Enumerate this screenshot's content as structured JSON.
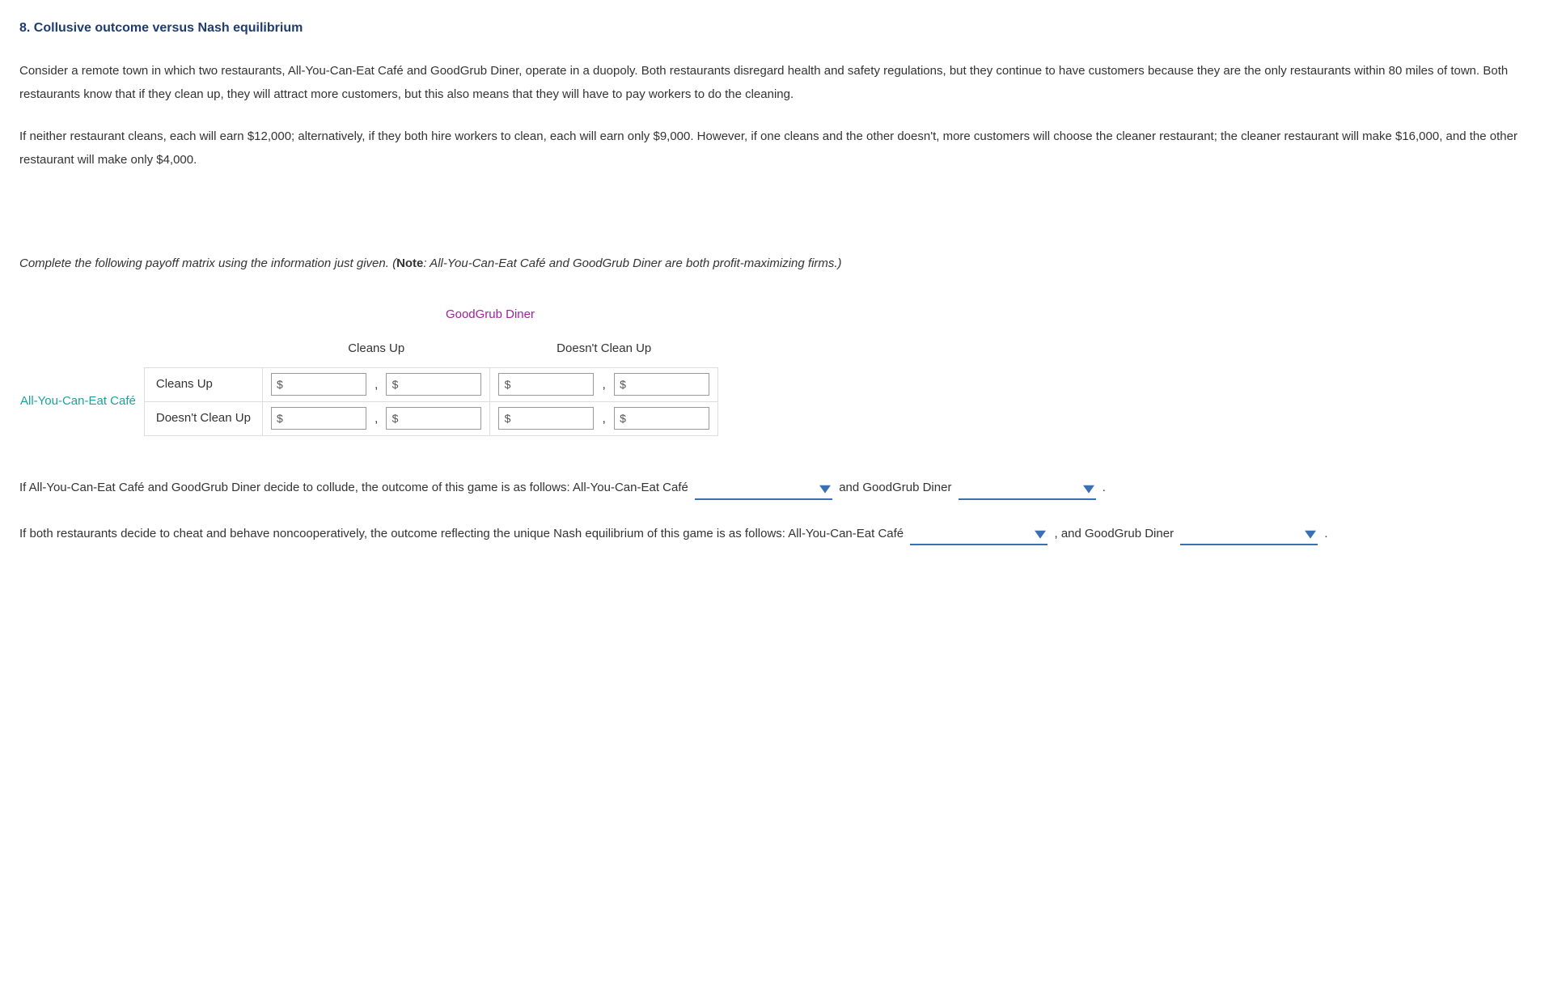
{
  "heading": "8. Collusive outcome versus Nash equilibrium",
  "para1": "Consider a remote town in which two restaurants, All-You-Can-Eat Café and GoodGrub Diner, operate in a duopoly. Both restaurants disregard health and safety regulations, but they continue to have customers because they are the only restaurants within 80 miles of town. Both restaurants know that if they clean up, they will attract more customers, but this also means that they will have to pay workers to do the cleaning.",
  "para2": "If neither restaurant cleans, each will earn $12,000; alternatively, if they both hire workers to clean, each will earn only $9,000. However, if one cleans and the other doesn't, more customers will choose the cleaner restaurant; the cleaner restaurant will make $16,000, and the other restaurant will make only $4,000.",
  "instruction_pre": "Complete the following payoff matrix using the information just given. (",
  "instruction_note_label": "Note",
  "instruction_post": ": All-You-Can-Eat Café and GoodGrub Diner are both profit-maximizing firms.)",
  "matrix": {
    "col_player": "GoodGrub Diner",
    "row_player": "All-You-Can-Eat Café",
    "col_strategies": [
      "Cleans Up",
      "Doesn't Clean Up"
    ],
    "row_strategies": [
      "Cleans Up",
      "Doesn't Clean Up"
    ],
    "currency": "$",
    "comma": ","
  },
  "q1": {
    "pre": "If All-You-Can-Eat Café and GoodGrub Diner decide to collude, the outcome of this game is as follows: All-You-Can-Eat Café ",
    "mid": " and GoodGrub Diner ",
    "end": " ."
  },
  "q2": {
    "pre": "If both restaurants decide to cheat and behave noncooperatively, the outcome reflecting the unique Nash equilibrium of this game is as follows: All-You-Can-Eat Café ",
    "mid": " , and GoodGrub Diner ",
    "end": " ."
  }
}
